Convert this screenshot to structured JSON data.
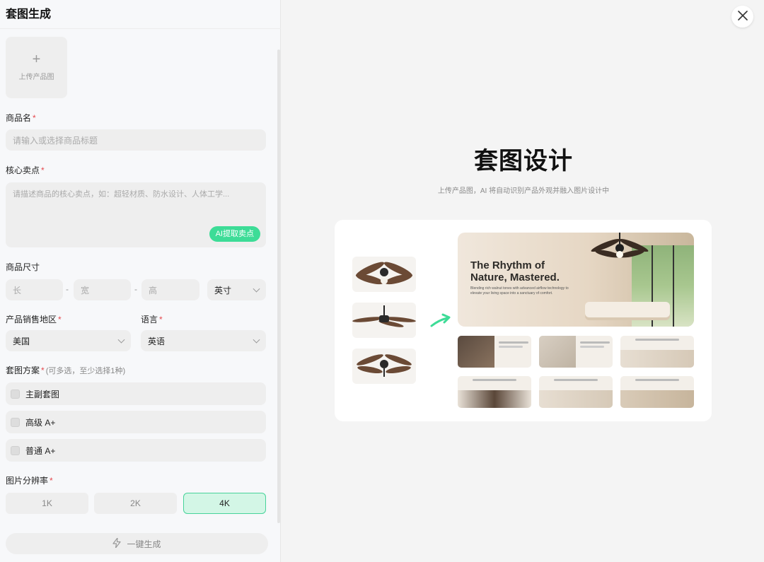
{
  "panel": {
    "title": "套图生成",
    "upload": {
      "plus": "+",
      "label": "上传产品图"
    },
    "product_name": {
      "label": "商品名",
      "required": "*",
      "placeholder": "请输入或选择商品标题"
    },
    "selling_points": {
      "label": "核心卖点",
      "required": "*",
      "placeholder": "请描述商品的核心卖点，如：超轻材质、防水设计、人体工学...",
      "ai_button": "AI提取卖点"
    },
    "size": {
      "label": "商品尺寸",
      "length": "长",
      "width": "宽",
      "height": "高",
      "separator": "-",
      "unit": "英寸"
    },
    "region": {
      "label": "产品销售地区",
      "required": "*",
      "value": "美国"
    },
    "language": {
      "label": "语言",
      "required": "*",
      "value": "英语"
    },
    "plan": {
      "label": "套图方案",
      "required": "*",
      "hint": "(可多选，至少选择1种)",
      "options": [
        "主副套图",
        "高级 A+",
        "普通 A+"
      ]
    },
    "resolution": {
      "label": "图片分辨率",
      "required": "*",
      "options": [
        "1K",
        "2K",
        "4K"
      ],
      "selected": "4K"
    },
    "generate_button": "一键生成"
  },
  "preview": {
    "title": "套图设计",
    "subtitle": "上传产品图，AI 将自动识别产品外观并融入图片设计中",
    "banner_heading_line1": "The Rhythm of",
    "banner_heading_line2": "Nature, Mastered.",
    "banner_body": "Blending rich walnut tones with advanced airflow technology to elevate your living space into a sanctuary of comfort."
  },
  "icons": {
    "close": "close-icon",
    "generate": "lightning-icon",
    "chevron": "chevron-down-icon"
  },
  "colors": {
    "accent": "#3ddc97",
    "accent_light": "#d3f6e6",
    "required": "#e5484d"
  }
}
